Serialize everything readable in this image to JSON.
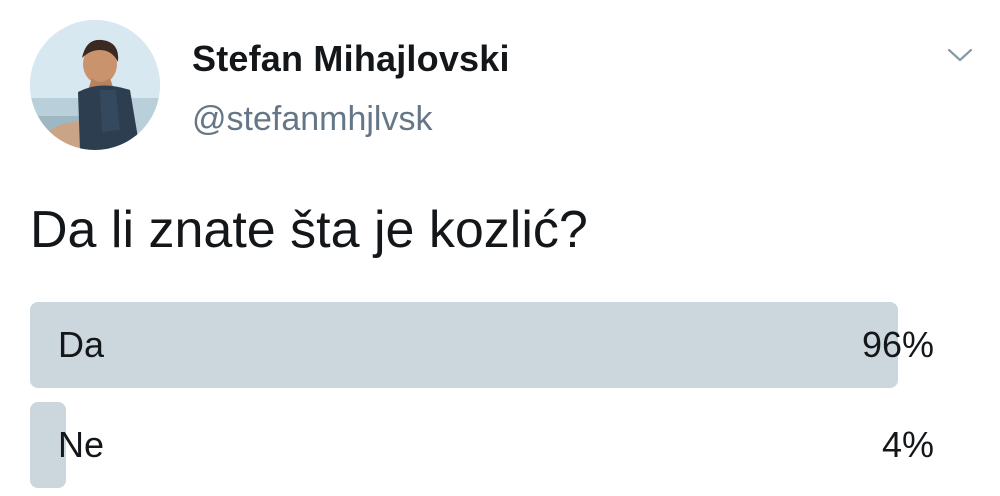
{
  "author": {
    "display_name": "Stefan Mihajlovski",
    "handle": "@stefanmhjlvsk",
    "avatar_icon": "profile-photo"
  },
  "menu": {
    "icon": "chevron-down-icon"
  },
  "tweet": {
    "text": "Da li znate šta je kozlić?"
  },
  "poll": {
    "options": [
      {
        "label": "Da",
        "percent_text": "96%",
        "percent": 96
      },
      {
        "label": "Ne",
        "percent_text": "4%",
        "percent": 4
      }
    ]
  },
  "colors": {
    "bar": "#ccd6dd",
    "text": "#14171a",
    "secondary_text": "#657786"
  }
}
